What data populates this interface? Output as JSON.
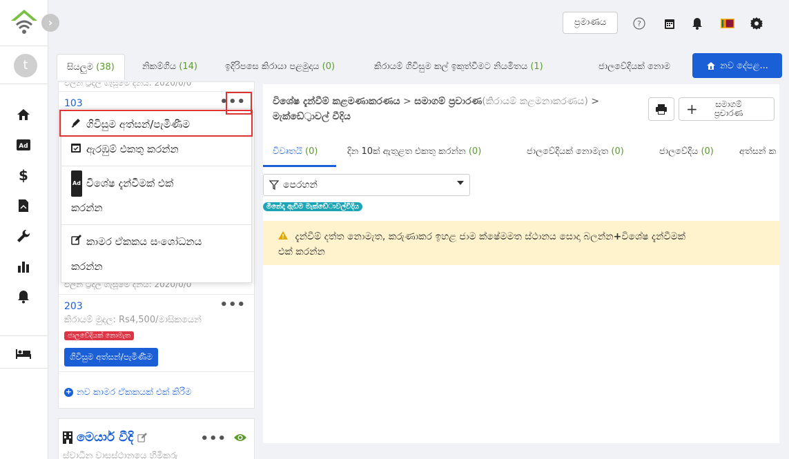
{
  "header": {
    "auth_button": "ප්‍රමාණය",
    "flag_label": "LK"
  },
  "user": {
    "avatar_letter": "t"
  },
  "tabs": [
    {
      "label": "සියලුම",
      "count": "(38)"
    },
    {
      "label": "නිකම්ගිය",
      "count": "(14)"
    },
    {
      "label": "ඉදිරිපසෙ කිරායා පළමුදාය",
      "count": "(0)"
    },
    {
      "label": "කිරායම් ගිවිසුම කල් ඉකුත්වීමට නියමිතය",
      "count": "(1)"
    },
    {
      "label": "ජාලවේදියක් නොම",
      "count": ""
    }
  ],
  "new_property_button": "නව දේපළ...",
  "units": {
    "top_partial_text": "ඵලින ට්‍රිදල ගැසූමේ දිනය: 2020/0/0",
    "unit_103": {
      "number": "103",
      "dots": "•••"
    },
    "unit_203": {
      "number": "203",
      "dots": "•••",
      "rent": "කිරායම් මුදල: Rs4,500/මාසිකයෙන්",
      "badge": "ජාලවේදියක් නොමැත",
      "button": "ගිවිසුම අත්සන්/පැමිණීම"
    },
    "partial_below_menu": "ඵලින ට්‍රිදල ගැසූමේ දිනය: 2020/0/0",
    "add_unit_link": "නව කාමර ඒකකයක් එක් කිරීම"
  },
  "dropdown": {
    "item_sign": "ගිවිසුම අත්සන්/පැමිණීම",
    "item_collect": "ඇරඹුම් එකතු කරන්න",
    "item_ad_line1": "විශේෂ දැන්වීමක් එක්",
    "item_ad_line2": "කරන්න",
    "item_edit_line1": "කාමර ඒකකය සංශෝධනය",
    "item_edit_line2": "කරන්න",
    "ad_badge": "Ad"
  },
  "property_card": {
    "name": "මෙයාර් වීදි",
    "dots": "•••",
    "subtitle": "ස්වාධීන වාසස්ථානයෙ හිමිකරු"
  },
  "main": {
    "breadcrumb_part1": "විශේෂ දැන්වීම් කළමණාකරණය",
    "breadcrumb_sep1": " > ",
    "breadcrumb_part2": "සමාගම් ප්‍රචාරණ",
    "breadcrumb_part2_light": "(කිරායම් කළමනාකරණය)",
    "breadcrumb_sep2": " > ",
    "breadcrumb_part3": "මැක්ඩේ්‍රාවල් වීදිය",
    "add_campaign_line1": "සමාගම්",
    "add_campaign_line2": "ප්‍රචාරණ",
    "sub_tabs": [
      {
        "label": "විවෘතයි",
        "count": "(0)"
      },
      {
        "label": "දින 10ක් ඇතුළත එකතු කරන්න",
        "count": "(0)"
      },
      {
        "label": "ජාලවේදියක් නොමැත",
        "count": "(0)"
      },
      {
        "label": "ජාලවේදිය",
        "count": "(0)"
      },
      {
        "label": "අත්සන් ක",
        "count": ""
      }
    ],
    "filter_label": "පෙරහන්",
    "filter_tag": "මිනේද්‍රු ඇඩීම මැක්ඩේාවල්වීදිය",
    "warning_line1": "දැන්වීම් දත්ත නොමැත, කරුණාකර ඉහළ ජාම ක්ෂේමමත ස්ථානය සොදා බලන්න",
    "warning_plus": "+",
    "warning_line1b": "විශේෂ දැන්වීමක්",
    "warning_line2": "එක් කරන්න"
  },
  "colors": {
    "primary": "#1a5fd6",
    "count_green": "#5a9a2b",
    "danger": "#dc3545",
    "teal": "#1ea5b5",
    "warning_bg": "#fff3cd"
  }
}
